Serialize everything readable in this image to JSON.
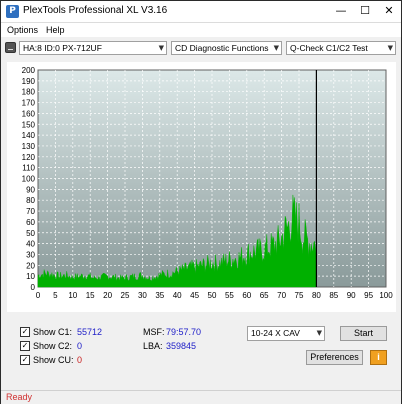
{
  "window": {
    "title": "PlexTools Professional XL V3.16",
    "minimize_glyph": "—",
    "maximize_glyph": "☐",
    "close_glyph": "✕",
    "app_icon_letter": "P"
  },
  "menu": {
    "items": [
      "Options",
      "Help"
    ]
  },
  "toolbar": {
    "drive": "HA:8 ID:0  PX-712UF",
    "function": "CD Diagnostic Functions",
    "test": "Q-Check C1/C2 Test"
  },
  "chart_data": {
    "type": "area",
    "title": "",
    "xlabel": "",
    "ylabel": "",
    "x_ticks": [
      "0",
      "5",
      "10",
      "15",
      "20",
      "25",
      "30",
      "35",
      "40",
      "45",
      "50",
      "55",
      "60",
      "65",
      "70",
      "75",
      "80",
      "85",
      "90",
      "95",
      "100"
    ],
    "y_ticks": [
      "0",
      "10",
      "20",
      "30",
      "40",
      "50",
      "60",
      "70",
      "80",
      "90",
      "100",
      "110",
      "120",
      "130",
      "140",
      "150",
      "160",
      "170",
      "180",
      "190",
      "200"
    ],
    "xlim": [
      0,
      100
    ],
    "ylim": [
      0,
      200
    ],
    "end_marker_x": 80,
    "series": [
      {
        "color": "#00b000",
        "x": [
          0,
          2,
          4,
          6,
          8,
          10,
          12,
          14,
          16,
          18,
          20,
          22,
          24,
          26,
          28,
          30,
          32,
          34,
          36,
          38,
          40,
          42,
          44,
          46,
          48,
          50,
          52,
          54,
          56,
          58,
          60,
          62,
          64,
          66,
          68,
          70,
          71,
          72,
          73,
          74,
          75,
          76,
          77,
          78,
          79,
          80
        ],
        "values": [
          12,
          14,
          13,
          11,
          12,
          10,
          11,
          12,
          9,
          10,
          11,
          10,
          9,
          10,
          11,
          12,
          9,
          11,
          13,
          14,
          16,
          18,
          20,
          21,
          23,
          25,
          24,
          27,
          29,
          30,
          34,
          36,
          37,
          40,
          43,
          50,
          58,
          62,
          72,
          68,
          66,
          52,
          50,
          46,
          45,
          44
        ]
      }
    ]
  },
  "stats": {
    "c1_label": "Show C1:",
    "c1_value": "55712",
    "c2_label": "Show C2:",
    "c2_value": "0",
    "cu_label": "Show CU:",
    "cu_value": "0",
    "msf_label": "MSF:",
    "msf_value": "79:57.70",
    "lba_label": "LBA:",
    "lba_value": "359845",
    "check_glyph": "✓"
  },
  "controls": {
    "speed": "10-24 X CAV",
    "start_label": "Start",
    "preferences_label": "Preferences",
    "info_glyph": "i"
  },
  "status": {
    "text": "Ready"
  },
  "colors": {
    "plot_bg_top": "#dce8e8",
    "plot_bg_bottom": "#8a9a9a",
    "series": "#00b000",
    "status": "#d03030"
  }
}
